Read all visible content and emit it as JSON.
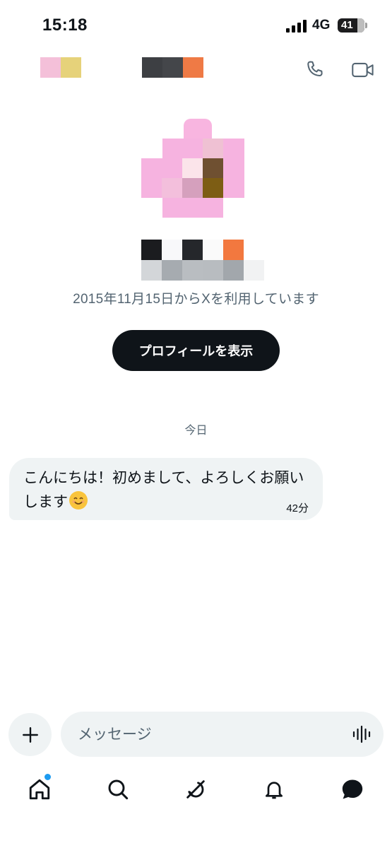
{
  "status_bar": {
    "time": "15:18",
    "network": "4G",
    "battery": "41"
  },
  "header": {
    "name_redacted": true,
    "icons": [
      "phone-icon",
      "video-camera-icon"
    ]
  },
  "profile": {
    "joined_text": "2015年11月15日からXを利用しています",
    "view_profile_label": "プロフィールを表示"
  },
  "conversation": {
    "date_divider": "今日",
    "messages": [
      {
        "text": "こんにちは！初めまして、よろしくお願いします",
        "emoji": "smiling-face-emoji",
        "time": "42分"
      }
    ]
  },
  "composer": {
    "placeholder": "メッセージ",
    "icons": [
      "plus-icon",
      "voice-waveform-icon"
    ]
  },
  "bottom_nav": {
    "items": [
      "home-icon",
      "search-icon",
      "grok-icon",
      "notifications-icon",
      "messages-icon"
    ]
  },
  "colors": {
    "accent": "#1d9bf0",
    "text_primary": "#0f1419",
    "text_secondary": "#536471",
    "bubble_bg": "#eff3f4",
    "button_dark": "#0f1419"
  }
}
